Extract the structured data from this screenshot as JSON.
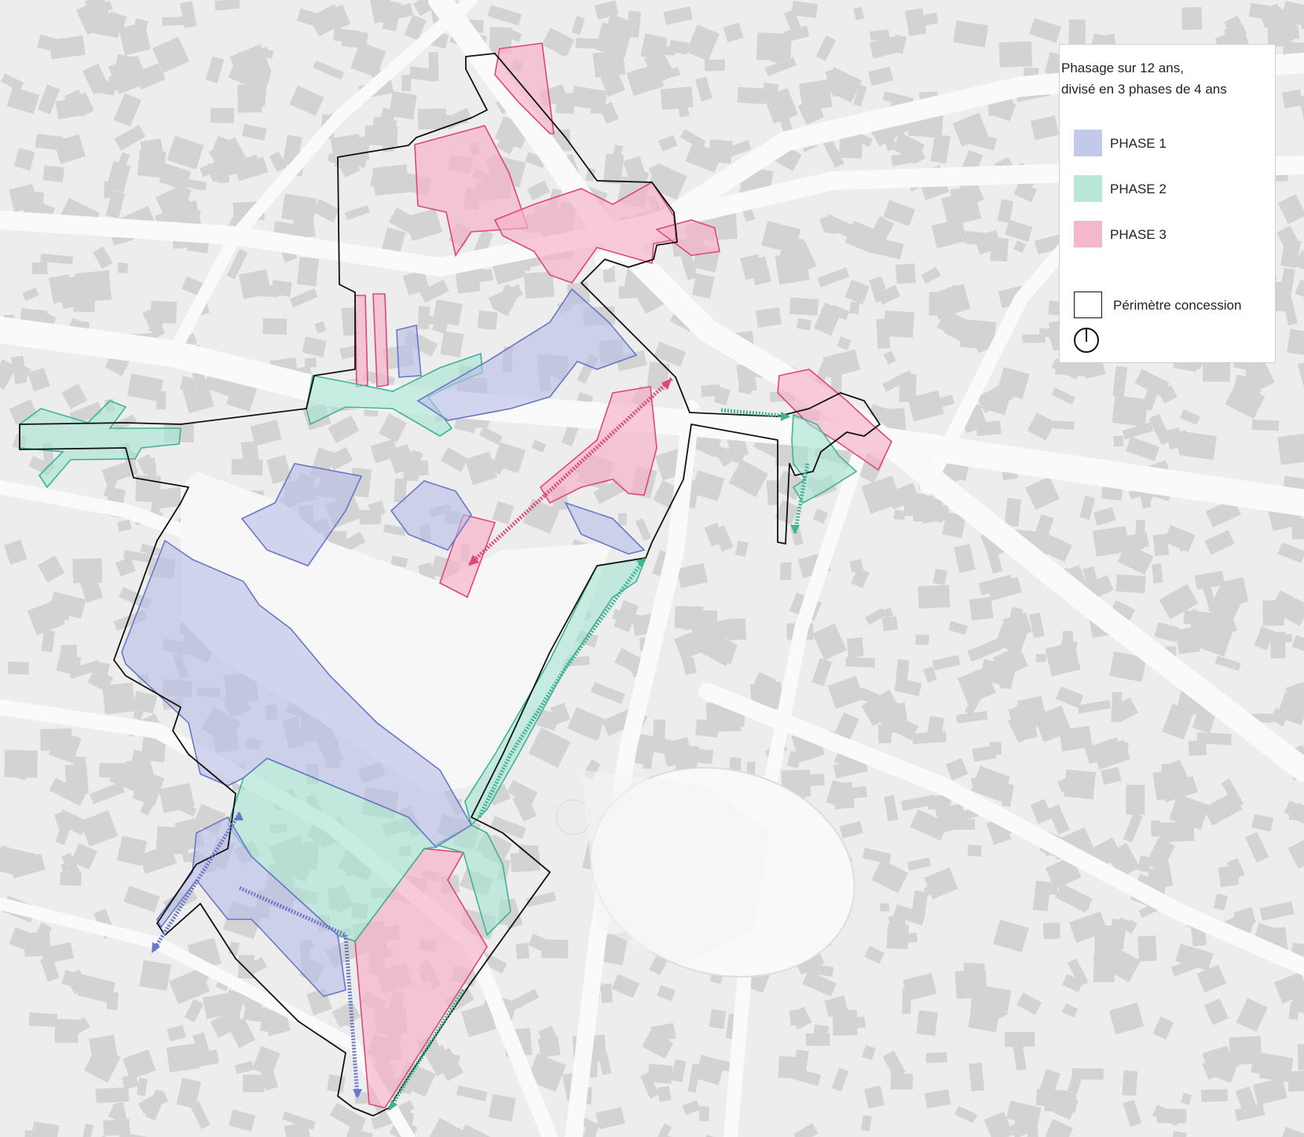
{
  "legend": {
    "title_line1": "Phasage sur 12 ans,",
    "title_line2": "divisé en 3 phases de 4 ans",
    "items": [
      {
        "label": "PHASE 1",
        "color": "#c3c9ea"
      },
      {
        "label": "PHASE 2",
        "color": "#b9e8d9"
      },
      {
        "label": "PHASE 3",
        "color": "#f4b8cc"
      }
    ],
    "perimeter_label": "Périmètre concession",
    "north_icon": "north-arrow-icon"
  },
  "colors": {
    "phase1_fill": "#b9bfe6",
    "phase2_fill": "#a8e4d3",
    "phase3_fill": "#f6b2c9",
    "perimeter_stroke": "#111111",
    "background": "#ededed"
  }
}
